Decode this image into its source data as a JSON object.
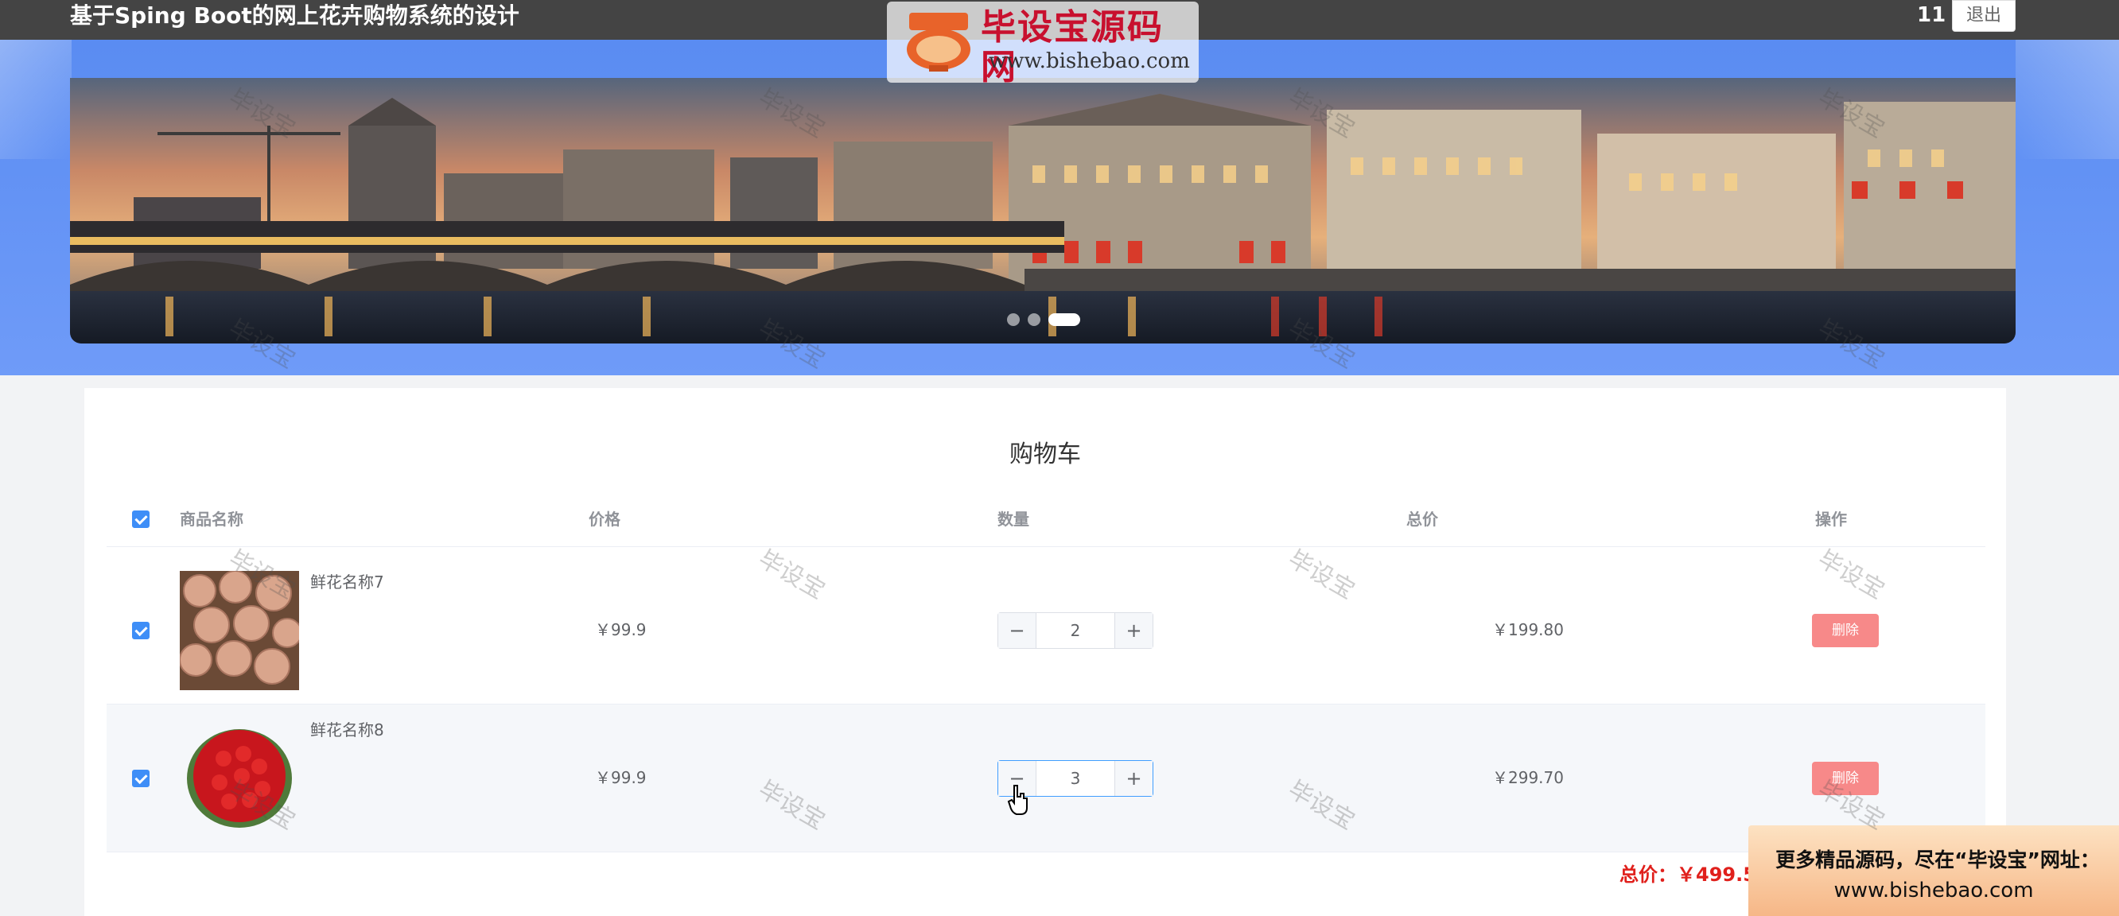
{
  "header": {
    "site_title": "基于Sping Boot的网上花卉购物系统的设计",
    "user_name": "11",
    "logout_label": "退出"
  },
  "watermark": {
    "logo_badge": "毕设宝",
    "logo_title": "毕设宝源码网",
    "logo_url": "www.bishebao.com",
    "text": "毕设宝"
  },
  "banner": {
    "slide_count": 3,
    "active_index": 2
  },
  "cart": {
    "title": "购物车",
    "columns": [
      "商品名称",
      "价格",
      "数量",
      "总价",
      "操作"
    ],
    "items": [
      {
        "name": "鲜花名称7",
        "price": "￥99.9",
        "quantity": "2",
        "total": "￥199.80",
        "delete_label": "删除",
        "checked": true
      },
      {
        "name": "鲜花名称8",
        "price": "￥99.9",
        "quantity": "3",
        "total": "￥299.70",
        "delete_label": "删除",
        "checked": true
      }
    ],
    "sum_label": "总价：￥499.50",
    "minus_symbol": "−",
    "plus_symbol": "+"
  },
  "promo": {
    "text": "更多精品源码，尽在“毕设宝”网址：",
    "url": "www.bishebao.com"
  },
  "colors": {
    "accent": "#3e8ef7",
    "danger": "#f78989",
    "sum": "#e0201c",
    "band": "#5a8cf2"
  }
}
